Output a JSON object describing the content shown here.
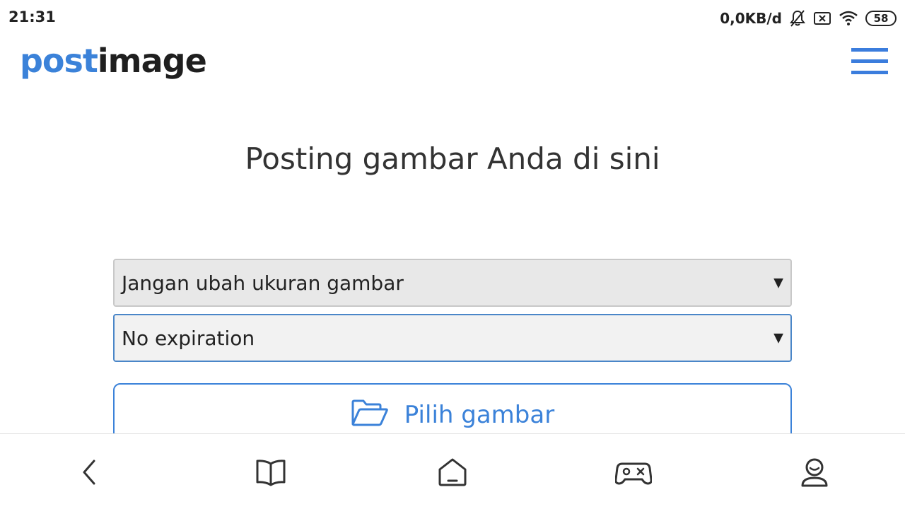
{
  "status_bar": {
    "time": "21:31",
    "net_speed": "0,0KB/d",
    "battery": "58",
    "icons": [
      "bell-muted-icon",
      "sim-off-icon",
      "wifi-icon",
      "battery-icon"
    ]
  },
  "header": {
    "logo_part1": "post",
    "logo_part2": "image",
    "menu_icon": "hamburger-menu-icon",
    "menu_color": "#3b7ddd"
  },
  "main": {
    "title": "Posting gambar Anda di sini",
    "resize_select": {
      "selected": "Jangan ubah ukuran gambar"
    },
    "expiry_select": {
      "selected": "No expiration"
    },
    "choose_button": {
      "label": "Pilih gambar",
      "icon": "folder-open-icon"
    },
    "accent_color": "#3b82d9"
  },
  "bottom_nav": {
    "items": [
      "back-icon",
      "book-icon",
      "home-icon",
      "gamepad-icon",
      "profile-icon"
    ]
  }
}
